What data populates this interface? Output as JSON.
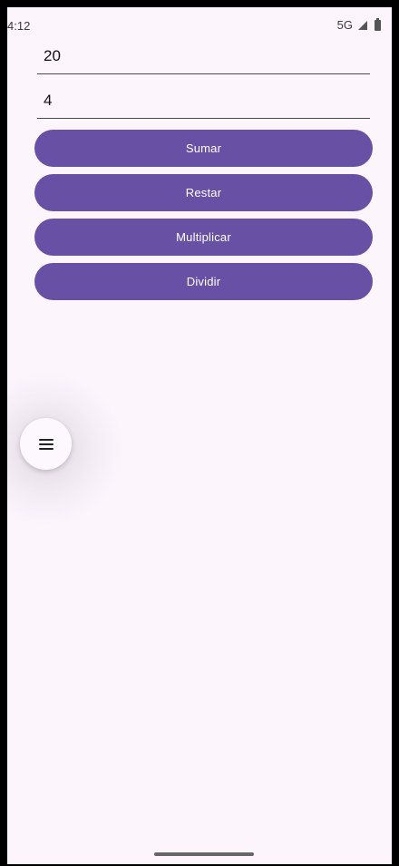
{
  "status_bar": {
    "time": "4:12",
    "network": "5G"
  },
  "inputs": {
    "first_value": "20",
    "second_value": "4"
  },
  "buttons": {
    "add": "Sumar",
    "subtract": "Restar",
    "multiply": "Multiplicar",
    "divide": "Dividir"
  },
  "icons": {
    "fab": "menu-icon",
    "signal": "signal-icon",
    "battery": "battery-icon"
  },
  "colors": {
    "background": "#fcf5fc",
    "primary": "#6851a4"
  }
}
